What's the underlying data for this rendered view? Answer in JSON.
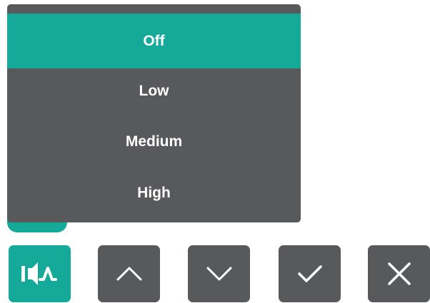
{
  "menu": {
    "items": [
      {
        "label": "Off",
        "selected": true
      },
      {
        "label": "Low",
        "selected": false
      },
      {
        "label": "Medium",
        "selected": false
      },
      {
        "label": "High",
        "selected": false
      }
    ]
  },
  "controls": {
    "buttons": [
      {
        "name": "audio-mode-button",
        "icon": "speaker-wave-icon",
        "active": true
      },
      {
        "name": "up-button",
        "icon": "chevron-up-icon",
        "active": false
      },
      {
        "name": "down-button",
        "icon": "chevron-down-icon",
        "active": false
      },
      {
        "name": "confirm-button",
        "icon": "check-icon",
        "active": false
      },
      {
        "name": "close-button",
        "icon": "close-icon",
        "active": false
      }
    ]
  },
  "colors": {
    "accent": "#14a999",
    "panel": "#58595b",
    "text": "#ffffff"
  }
}
